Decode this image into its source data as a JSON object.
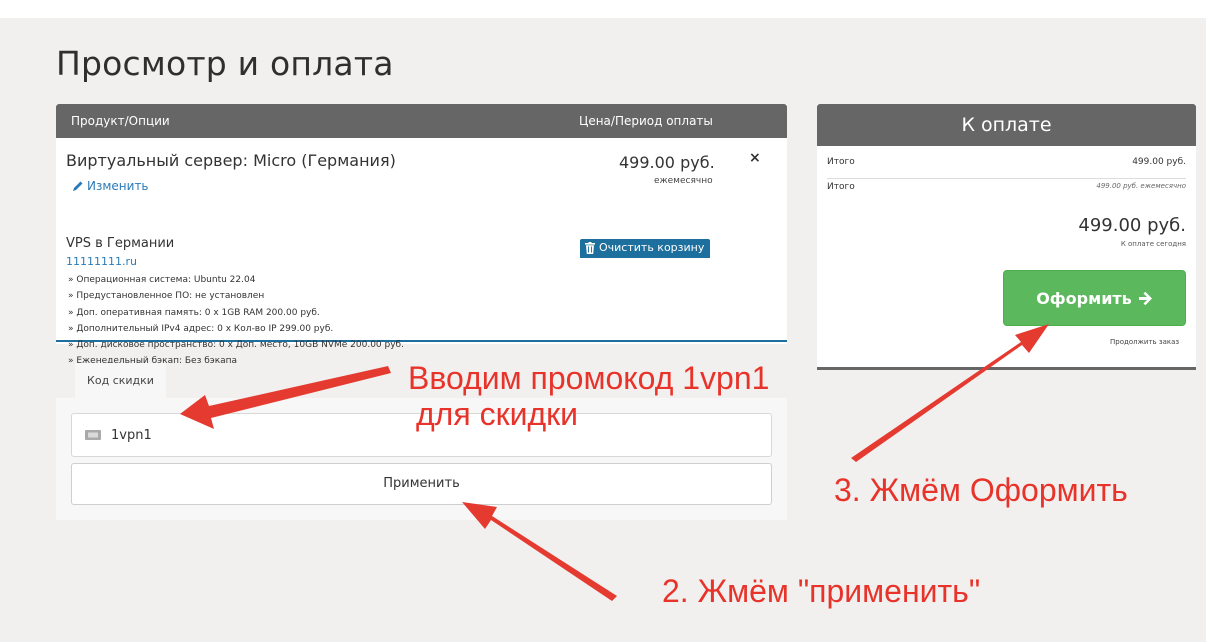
{
  "page": {
    "title": "Просмотр и оплата"
  },
  "cart": {
    "header": {
      "product_col": "Продукт/Опции",
      "price_col": "Цена/Период оплаты"
    },
    "item": {
      "name": "Виртуальный сервер: Micro (Германия)",
      "edit_label": "Изменить",
      "group": "VPS в Германии",
      "domain": "11111111.ru",
      "options": [
        "» Операционная система: Ubuntu 22.04",
        "» Предустановленное ПО: не установлен",
        "» Доп. оперативная память: 0 x 1GB RAM 200.00 руб.",
        "» Дополнительный IPv4 адрес: 0 x Кол-во IP 299.00 руб.",
        "» Доп. дисковое пространство: 0 x Доп. место, 10GB NVMe 200.00 руб.",
        "» Еженедельный бэкап: Без бэкапа"
      ],
      "price": "499.00 руб.",
      "period": "ежемесячно",
      "remove_glyph": "×"
    },
    "clear_label": "Очистить корзину"
  },
  "promo": {
    "tab_label": "Код скидки",
    "input_value": "1vpn1",
    "apply_label": "Применить"
  },
  "summary": {
    "title": "К оплате",
    "subtotal_label": "Итого",
    "subtotal_value": "499.00 руб.",
    "recurring_label": "Итого",
    "recurring_value": "499.00 руб. ежемесячно",
    "total": "499.00 руб.",
    "total_note": "К оплате сегодня",
    "checkout_label": "Оформить",
    "continue_label": "Продолжить заказ"
  },
  "annotations": {
    "step1_line1": "Вводим промокод 1vpn1",
    "step1_line2": "для скидки",
    "step2": "2. Жмём \"применить\"",
    "step3": "3. Жмём Оформить"
  },
  "colors": {
    "header_gray": "#666666",
    "link_blue": "#2a7ab8",
    "clear_blue": "#1d6f9e",
    "checkout_green": "#5cb85c",
    "annotation_red": "#e8332a"
  }
}
